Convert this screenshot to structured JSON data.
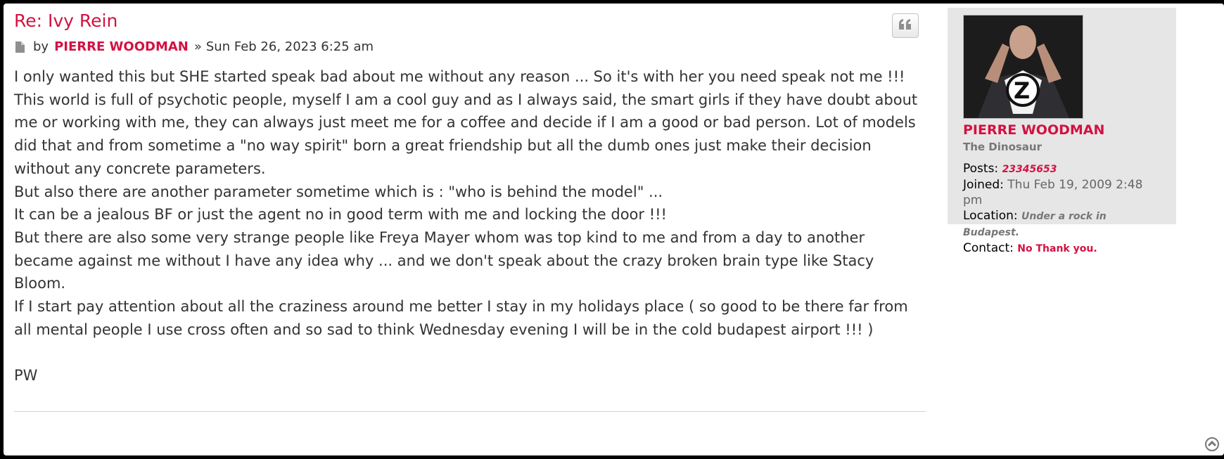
{
  "post": {
    "title": "Re: Ivy Rein",
    "by_label": "by",
    "author": "PIERRE WOODMAN",
    "separator": "»",
    "date": "Sun Feb 26, 2023 6:25 am",
    "body_lines": [
      "I only wanted this but SHE started speak bad about me without any reason ... So it's with her you need speak not me !!!",
      "This world is full of psychotic people, myself I am a cool guy and as I always said, the smart girls if they have doubt about me or working with me, they can always just meet me for a coffee and decide if I am a good or bad person. Lot of models did that and from sometime a \"no way spirit\" born a great friendship but all the dumb ones just make their decision without any concrete parameters.",
      "But also there are another parameter sometime which is : \"who is behind the model\" ...",
      "It can be a jealous BF or just the agent no in good term with me and locking the door !!!",
      "But there are also some very strange people like Freya Mayer whom was top kind to me and from a day to another became against me without I have any idea why ... and we don't speak about the crazy broken brain type like Stacy Bloom.",
      "If I start pay attention about all the craziness around me better I stay in my holidays place ( so good to be there far from all mental people I use cross often and so sad to think Wednesday evening I will be in the cold budapest airport !!! )",
      "",
      "PW"
    ]
  },
  "profile": {
    "name": "PIERRE WOODMAN",
    "rank": "The Dinosaur",
    "posts_label": "Posts:",
    "posts_value": "23345653",
    "joined_label": "Joined:",
    "joined_value": "Thu Feb 19, 2009 2:48 pm",
    "location_label": "Location:",
    "location_value": "Under a rock in Budapest.",
    "contact_label": "Contact:",
    "contact_value": "No Thank you.",
    "avatar_letter": "Z"
  },
  "colors": {
    "accent": "#d31141",
    "profile_bg": "#e6e6e6",
    "text": "#333333"
  },
  "icons": {
    "post": "post-icon",
    "quote": "quote-icon",
    "top": "back-to-top-icon"
  }
}
